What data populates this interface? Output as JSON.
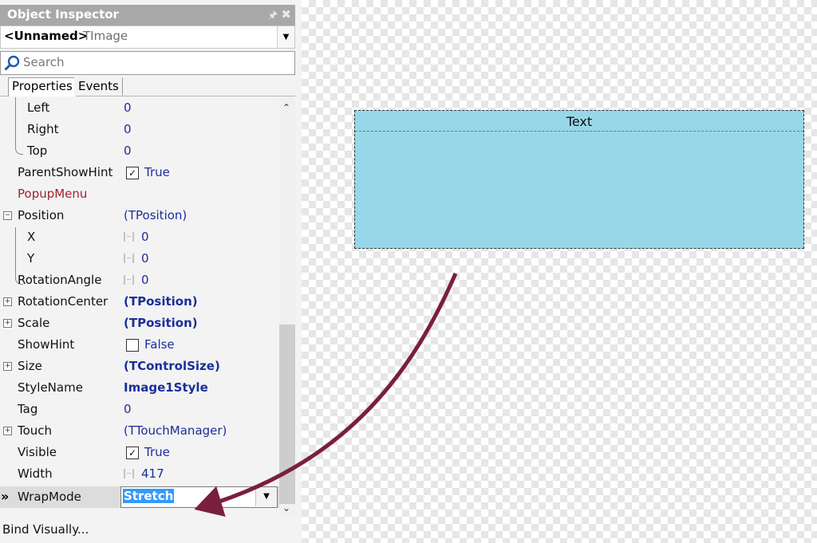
{
  "inspector": {
    "title": "Object Inspector",
    "object_name": "<Unnamed>",
    "object_class": "TImage",
    "search_placeholder": "Search",
    "tabs": [
      "Properties",
      "Events"
    ],
    "rows": [
      {
        "name": "Left",
        "value": "0"
      },
      {
        "name": "Right",
        "value": "0"
      },
      {
        "name": "Top",
        "value": "0"
      },
      {
        "name": "ParentShowHint",
        "value": "True",
        "checked": true
      },
      {
        "name": "PopupMenu",
        "value": ""
      },
      {
        "name": "Position",
        "value": "(TPosition)",
        "expanded": true
      },
      {
        "name": "X",
        "value": "0"
      },
      {
        "name": "Y",
        "value": "0"
      },
      {
        "name": "RotationAngle",
        "value": "0"
      },
      {
        "name": "RotationCenter",
        "value": "(TPosition)"
      },
      {
        "name": "Scale",
        "value": "(TPosition)"
      },
      {
        "name": "ShowHint",
        "value": "False",
        "checked": false
      },
      {
        "name": "Size",
        "value": "(TControlSize)"
      },
      {
        "name": "StyleName",
        "value": "Image1Style"
      },
      {
        "name": "Tag",
        "value": "0"
      },
      {
        "name": "Touch",
        "value": "(TTouchManager)"
      },
      {
        "name": "Visible",
        "value": "True",
        "checked": true
      },
      {
        "name": "Width",
        "value": "417"
      },
      {
        "name": "WrapMode",
        "value": "Stretch",
        "selected": true
      }
    ],
    "selected_marker": "»",
    "bind_visually": "Bind Visually..."
  },
  "canvas": {
    "label": "Text",
    "fill_color": "#97d7e8"
  },
  "annotation": {
    "arrow_color": "#7a1f3d"
  }
}
